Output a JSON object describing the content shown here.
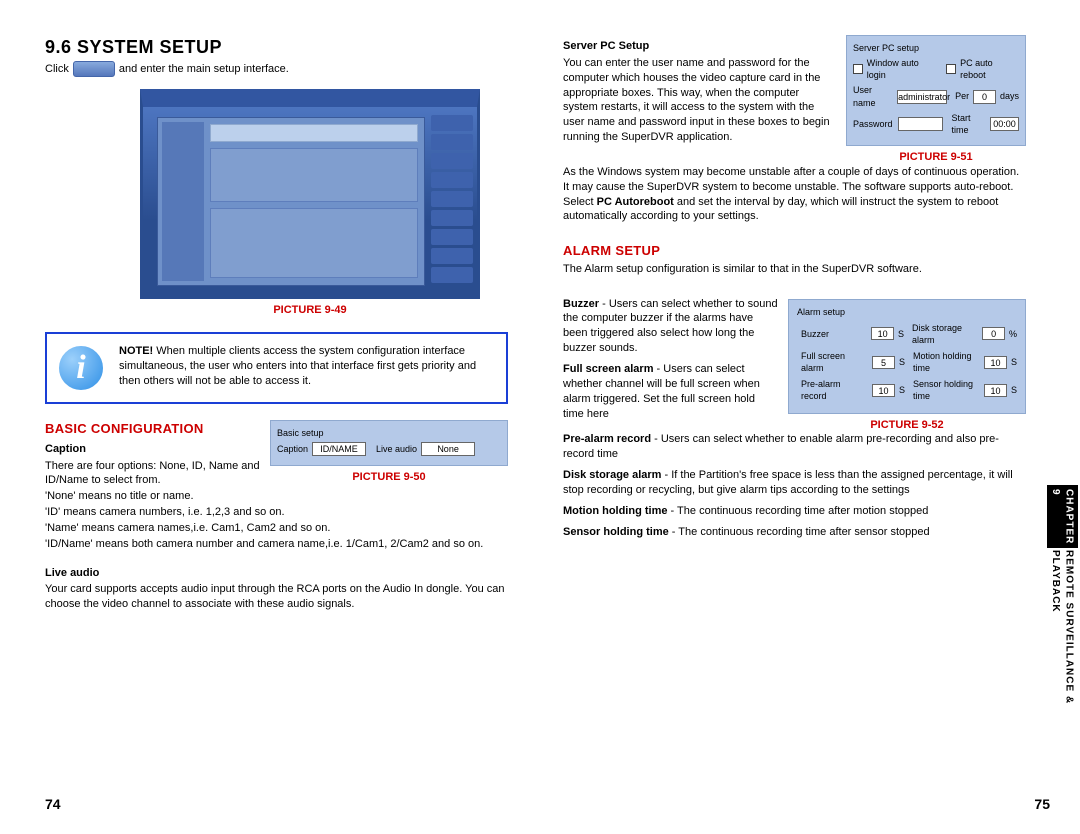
{
  "left": {
    "heading": "9.6 SYSTEM SETUP",
    "click_before": "Click",
    "click_after": "and enter the main setup interface.",
    "pic49": "PICTURE 9-49",
    "note_bold": "NOTE!",
    "note_text": "When multiple clients access the system configuration interface simultaneous, the user who enters into that interface first gets priority and then others will not be able to access it.",
    "basic_conf": "BASIC CONFIGURATION",
    "caption_head": "Caption",
    "caption_p1": "There are four options: None, ID, Name and ID/Name to select from.",
    "caption_p2": "'None' means no title or name.",
    "caption_p3": "'ID' means camera numbers, i.e. 1,2,3 and so on.",
    "caption_p4": "'Name' means camera names,i.e. Cam1, Cam2 and so on.",
    "caption_p5": "'ID/Name' means both camera number and camera name,i.e. 1/Cam1, 2/Cam2 and so on.",
    "pic50": "PICTURE 9-50",
    "liveaudio_head": "Live audio",
    "liveaudio_text": "Your card supports accepts audio input through the RCA ports on the Audio In dongle. You can choose the video channel to associate with these audio signals.",
    "fig50": {
      "title": "Basic setup",
      "caption_lbl": "Caption",
      "caption_val": "ID/NAME",
      "liveaudio_lbl": "Live audio",
      "liveaudio_val": "None"
    },
    "pagenum": "74"
  },
  "right": {
    "server_head": "Server PC Setup",
    "server_p1": "You can enter the user name and password for the computer which houses the video capture card in the appropriate boxes. This way, when the computer system restarts, it will access to the system with the user name and password input in these boxes to begin running the SuperDVR application.",
    "server_p2a": "As the Windows system may become unstable after a couple of days of continuous operation. It may cause the SuperDVR system to become unstable. The software supports auto-reboot. Select ",
    "server_p2b": "PC Autoreboot",
    "server_p2c": " and set the interval by day, which will instruct the system to reboot automatically according to your settings.",
    "pic51": "PICTURE 9-51",
    "fig51": {
      "title": "Server PC setup",
      "win_auto": "Window auto login",
      "pc_reboot": "PC auto reboot",
      "uname_lbl": "User name",
      "uname_val": "administrator",
      "per_lbl": "Per",
      "per_val": "0",
      "per_unit": "days",
      "pwd_lbl": "Password",
      "pwd_val": "",
      "start_lbl": "Start time",
      "start_val": "00:00"
    },
    "alarm_head": "ALARM SETUP",
    "alarm_intro": "The Alarm setup configuration is similar to that in the SuperDVR software.",
    "buzzer_lbl": "Buzzer",
    "buzzer_desc": " - Users can select whether to sound the computer buzzer if the alarms have been triggered also select how long the buzzer sounds.",
    "fullscreen_lbl": "Full screen alarm",
    "fullscreen_desc": " - Users can select whether channel will be full screen when alarm triggered. Set the full screen hold time here",
    "prealarm_lbl": "Pre-alarm record",
    "prealarm_desc": " - Users can select whether to enable alarm pre-recording and also pre-record time",
    "disk_lbl": "Disk storage alarm",
    "disk_desc": " - If the Partition's free space is less than the assigned percentage, it will stop recording or recycling, but give alarm tips according to the settings",
    "motion_lbl": "Motion holding time",
    "motion_desc": " - The continuous recording time after motion stopped",
    "sensor_lbl": "Sensor holding time",
    "sensor_desc": " - The continuous recording time after sensor stopped",
    "pic52": "PICTURE 9-52",
    "fig52": {
      "title": "Alarm setup",
      "buzzer": "Buzzer",
      "buzzer_v": "10",
      "buzzer_u": "S",
      "disk": "Disk storage alarm",
      "disk_v": "0",
      "disk_u": "%",
      "full": "Full screen alarm",
      "full_v": "5",
      "full_u": "S",
      "motion": "Motion holding time",
      "motion_v": "10",
      "motion_u": "S",
      "pre": "Pre-alarm record",
      "pre_v": "10",
      "pre_u": "S",
      "sensor": "Sensor holding time",
      "sensor_v": "10",
      "sensor_u": "S"
    },
    "chapter_num": "CHAPTER 9",
    "chapter_title": "REMOTE SURVEILLANCE & PLAYBACK",
    "pagenum": "75"
  }
}
